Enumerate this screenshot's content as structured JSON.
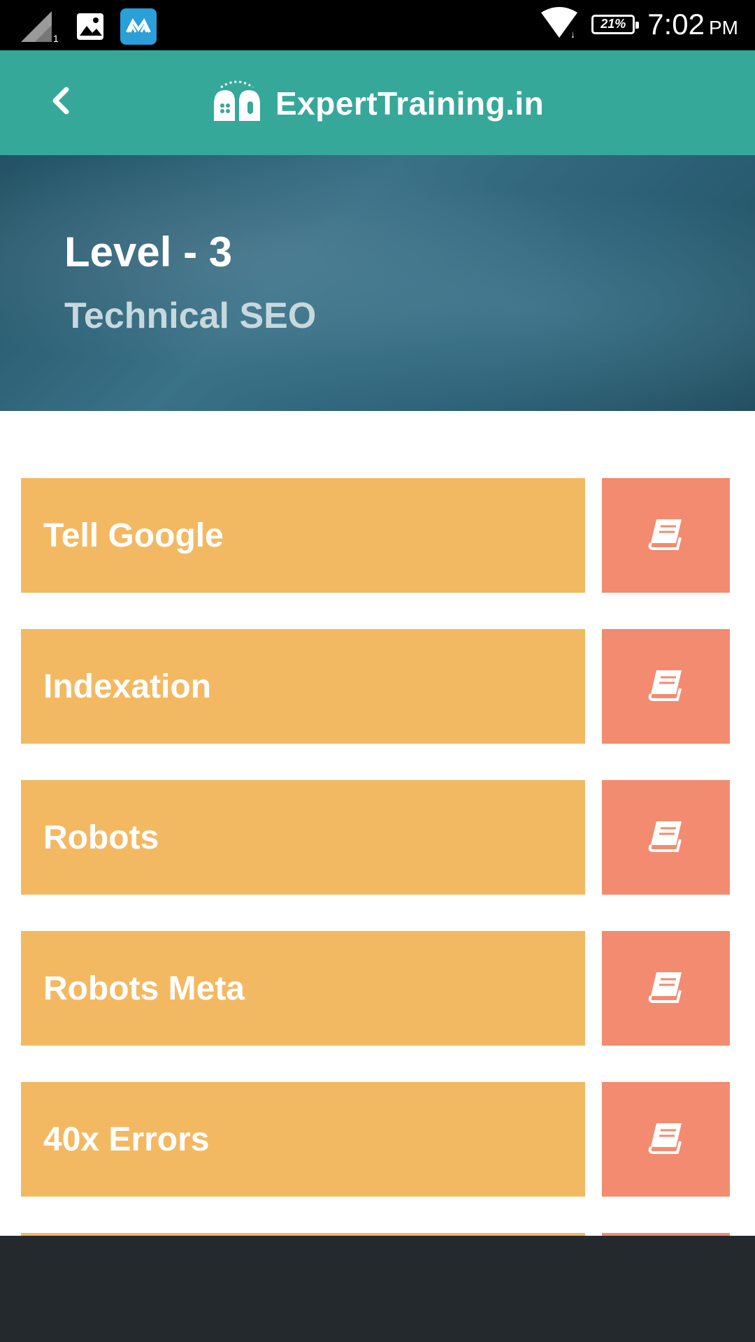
{
  "status_bar": {
    "time": "7:02",
    "ampm": "PM",
    "battery": "21%",
    "icons": [
      "signal-icon",
      "gallery-icon",
      "app-icon",
      "wifi-icon",
      "battery-icon"
    ]
  },
  "app_bar": {
    "brand": "ExpertTraining.in",
    "back_icon": "chevron-left-icon",
    "color": "#36a899"
  },
  "hero": {
    "title": "Level - 3",
    "subtitle": "Technical SEO"
  },
  "topics": [
    {
      "label": "Tell Google",
      "icon": "book-icon"
    },
    {
      "label": "Indexation",
      "icon": "book-icon"
    },
    {
      "label": "Robots",
      "icon": "book-icon"
    },
    {
      "label": "Robots Meta",
      "icon": "book-icon"
    },
    {
      "label": "40x Errors",
      "icon": "book-icon"
    }
  ],
  "colors": {
    "topic_bg": "#f3b962",
    "book_bg": "#f28b6f",
    "bottom_bar": "#24292e"
  }
}
